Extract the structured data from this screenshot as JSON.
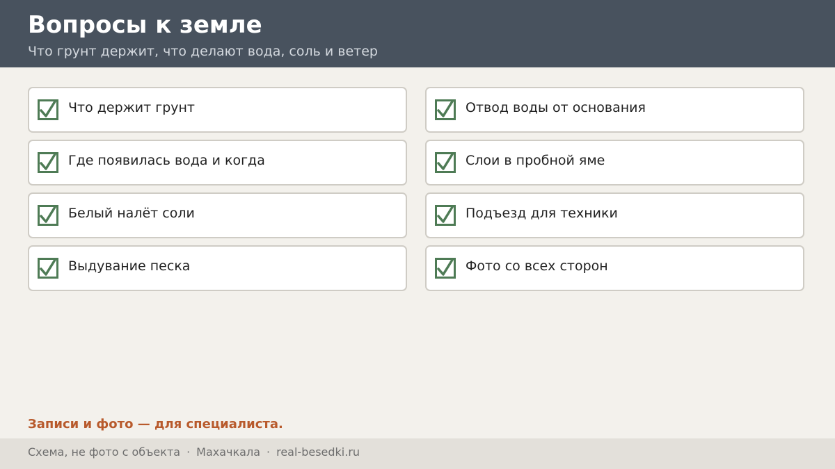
{
  "header": {
    "title": "Вопросы к земле",
    "subtitle": "Что грунт держит, что делают вода, соль и ветер"
  },
  "checklist": {
    "icon": "checked-checkbox-icon",
    "check_color": "#4e7b55",
    "left": [
      {
        "label": "Что держит грунт",
        "checked": true
      },
      {
        "label": "Где появилась вода и когда",
        "checked": true
      },
      {
        "label": "Белый налёт соли",
        "checked": true
      },
      {
        "label": "Выдувание песка",
        "checked": true
      }
    ],
    "right": [
      {
        "label": "Отвод воды от основания",
        "checked": true
      },
      {
        "label": "Слои в пробной яме",
        "checked": true
      },
      {
        "label": "Подъезд для техники",
        "checked": true
      },
      {
        "label": "Фото со всех сторон",
        "checked": true
      }
    ]
  },
  "note": "Записи и фото — для специалиста.",
  "footer": {
    "disclaimer": "Схема, не фото с объекта",
    "separator": "·",
    "city": "Махачкала",
    "site": "real-besedki.ru"
  },
  "colors": {
    "header_bg": "#48525e",
    "page_bg": "#f3f1ec",
    "accent": "#b85a2c",
    "footer_bg": "#e3e0da"
  }
}
